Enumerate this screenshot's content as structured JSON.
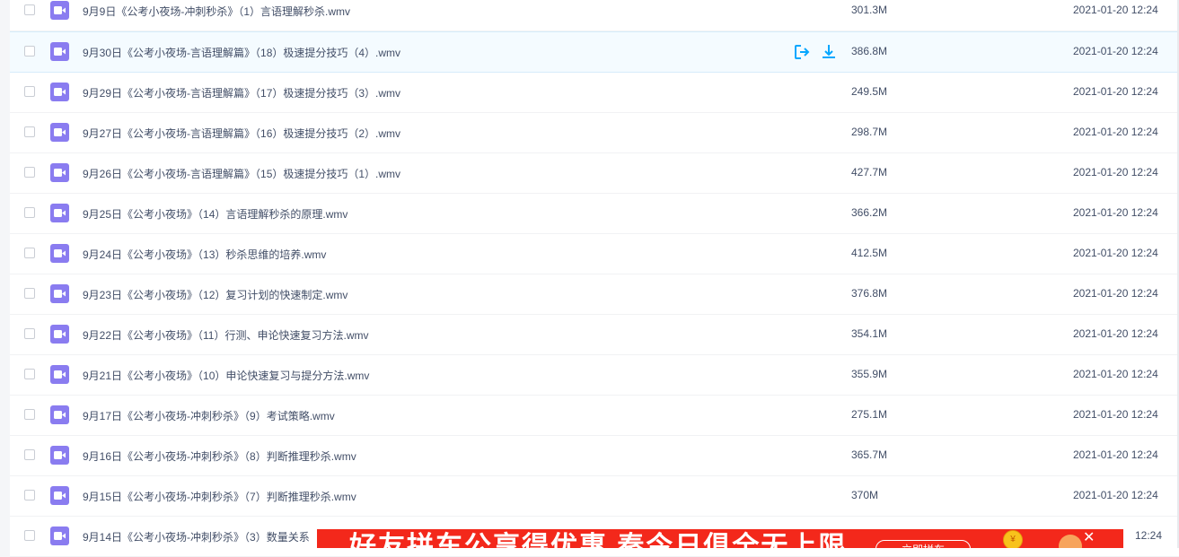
{
  "files": [
    {
      "name": "9月9日《公考小夜场-冲刺秒杀》（1）言语理解秒杀.wmv",
      "size": "301.3M",
      "date": "2021-01-20 12:24"
    },
    {
      "name": "9月30日《公考小夜场-言语理解篇》（18）极速提分技巧（4）.wmv",
      "size": "386.8M",
      "date": "2021-01-20 12:24",
      "hover": true
    },
    {
      "name": "9月29日《公考小夜场-言语理解篇》（17）极速提分技巧（3）.wmv",
      "size": "249.5M",
      "date": "2021-01-20 12:24"
    },
    {
      "name": "9月27日《公考小夜场-言语理解篇》（16）极速提分技巧（2）.wmv",
      "size": "298.7M",
      "date": "2021-01-20 12:24"
    },
    {
      "name": "9月26日《公考小夜场-言语理解篇》（15）极速提分技巧（1）.wmv",
      "size": "427.7M",
      "date": "2021-01-20 12:24"
    },
    {
      "name": "9月25日《公考小夜场》（14）言语理解秒杀的原理.wmv",
      "size": "366.2M",
      "date": "2021-01-20 12:24"
    },
    {
      "name": "9月24日《公考小夜场》（13）秒杀思维的培养.wmv",
      "size": "412.5M",
      "date": "2021-01-20 12:24"
    },
    {
      "name": "9月23日《公考小夜场》（12）复习计划的快速制定.wmv",
      "size": "376.8M",
      "date": "2021-01-20 12:24"
    },
    {
      "name": "9月22日《公考小夜场》（11）行测、申论快速复习方法.wmv",
      "size": "354.1M",
      "date": "2021-01-20 12:24"
    },
    {
      "name": "9月21日《公考小夜场》（10）申论快速复习与提分方法.wmv",
      "size": "355.9M",
      "date": "2021-01-20 12:24"
    },
    {
      "name": "9月17日《公考小夜场-冲刺秒杀》（9）考试策略.wmv",
      "size": "275.1M",
      "date": "2021-01-20 12:24"
    },
    {
      "name": "9月16日《公考小夜场-冲刺秒杀》（8）判断推理秒杀.wmv",
      "size": "365.7M",
      "date": "2021-01-20 12:24"
    },
    {
      "name": "9月15日《公考小夜场-冲刺秒杀》（7）判断推理秒杀.wmv",
      "size": "370M",
      "date": "2021-01-20 12:24"
    },
    {
      "name": "9月14日《公考小夜场-冲刺秒杀》（3）数量关系",
      "size": "",
      "date": "12:24"
    }
  ],
  "file_icon": "video-file-icon",
  "hover_actions": [
    "share-icon",
    "download-icon"
  ],
  "banner": {
    "text": "好友拼车公享得优惠 秦今日俱全无上限",
    "button": "立即拼车",
    "coin": "¥"
  },
  "colors": {
    "accent": "#06a7ff",
    "file_icon": "#8a7cf0",
    "banner": "#f3281b"
  }
}
